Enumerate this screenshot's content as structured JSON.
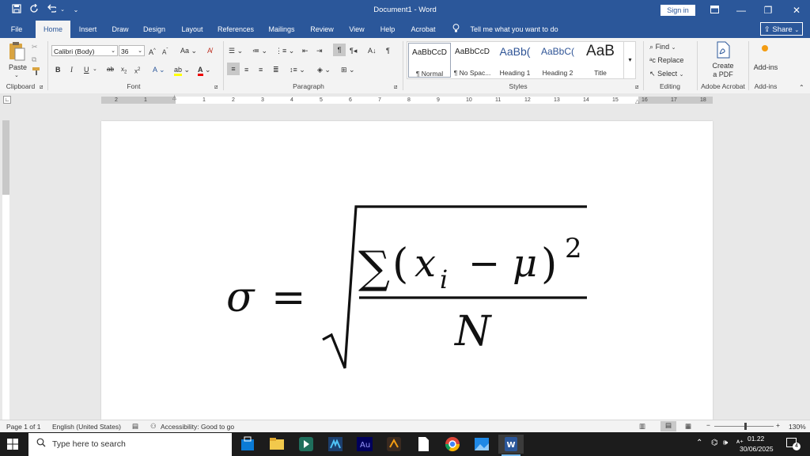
{
  "titlebar": {
    "doc_title": "Document1  -  Word",
    "sign_in": "Sign in"
  },
  "tabs": [
    {
      "label": "File"
    },
    {
      "label": "Home"
    },
    {
      "label": "Insert"
    },
    {
      "label": "Draw"
    },
    {
      "label": "Design"
    },
    {
      "label": "Layout"
    },
    {
      "label": "References"
    },
    {
      "label": "Mailings"
    },
    {
      "label": "Review"
    },
    {
      "label": "View"
    },
    {
      "label": "Help"
    },
    {
      "label": "Acrobat"
    }
  ],
  "tell_me": "Tell me what you want to do",
  "share": "Share",
  "ribbon": {
    "clipboard": {
      "label": "Clipboard",
      "paste": "Paste"
    },
    "font": {
      "label": "Font",
      "font_name": "Calibri (Body)",
      "font_size": "36"
    },
    "paragraph": {
      "label": "Paragraph"
    },
    "styles": {
      "label": "Styles",
      "items": [
        {
          "sample": "AaBbCcD",
          "name": "¶ Normal"
        },
        {
          "sample": "AaBbCcD",
          "name": "¶ No Spac..."
        },
        {
          "sample": "AaBb(",
          "name": "Heading 1"
        },
        {
          "sample": "AaBbC(",
          "name": "Heading 2"
        },
        {
          "sample": "AaB",
          "name": "Title"
        }
      ]
    },
    "editing": {
      "label": "Editing",
      "find": "Find",
      "replace": "Replace",
      "select": "Select"
    },
    "acrobat": {
      "label": "Adobe Acrobat",
      "create1": "Create",
      "create2": "a PDF"
    },
    "addins": {
      "label": "Add-ins",
      "button": "Add-ins"
    }
  },
  "ruler_numbers": [
    "2",
    "1",
    "1",
    "2",
    "3",
    "4",
    "5",
    "6",
    "7",
    "8",
    "9",
    "10",
    "11",
    "12",
    "13",
    "14",
    "15",
    "16",
    "17",
    "18"
  ],
  "equation": {
    "sigma": "σ",
    "equals": "=",
    "sum": "∑",
    "open": "(",
    "x": "x",
    "i": "i",
    "minus": "−",
    "mu": "μ",
    "close": ")",
    "sq": "2",
    "N": "N"
  },
  "statusbar": {
    "page": "Page 1 of 1",
    "language": "English (United States)",
    "accessibility": "Accessibility: Good to go",
    "zoom": "130%"
  },
  "taskbar": {
    "search_placeholder": "Type here to search",
    "time": "01.22",
    "date": "30/06/2025",
    "notifications": "4"
  },
  "colors": {
    "word_blue": "#2b579a"
  }
}
